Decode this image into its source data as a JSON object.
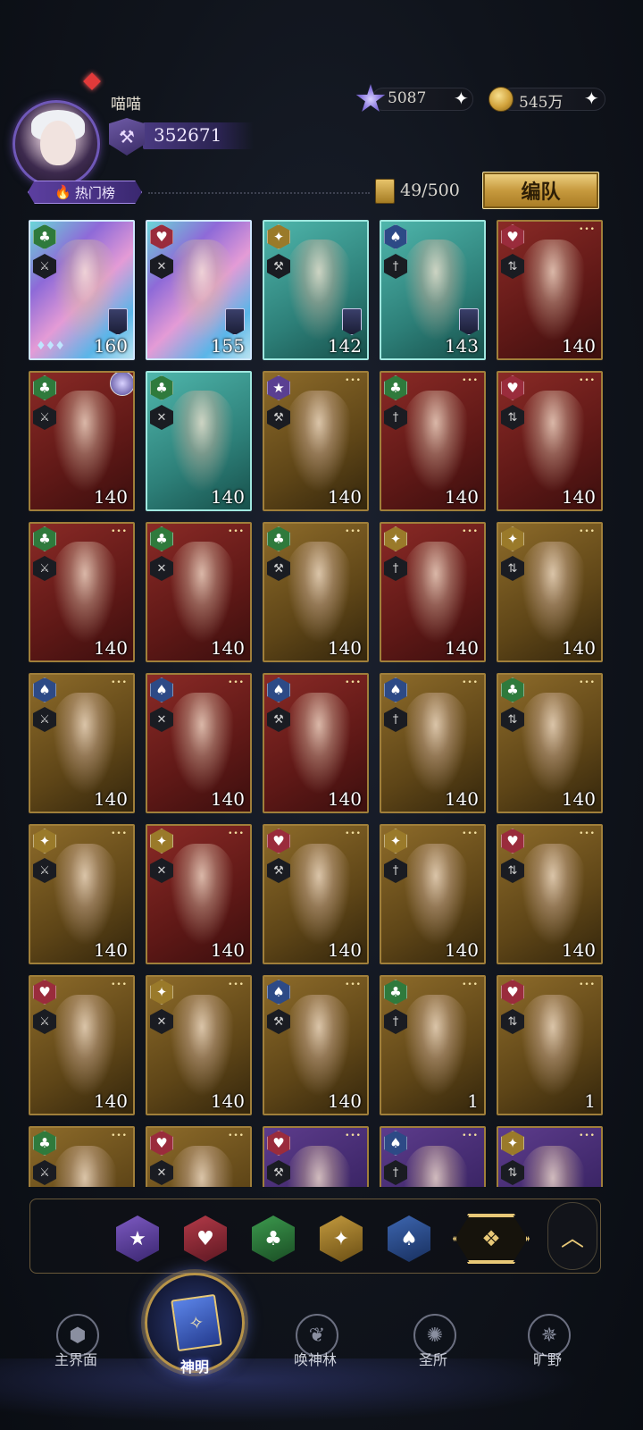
{
  "player": {
    "name": "喵喵",
    "power": "352671"
  },
  "currencies": [
    {
      "icon": "star-gem-icon",
      "value": "5087"
    },
    {
      "icon": "gold-coin-icon",
      "value": "545万"
    }
  ],
  "toolbar": {
    "hot_label": "热门榜",
    "card_count": "49/500",
    "team_button": "编队"
  },
  "cards": [
    {
      "suit": "club",
      "bg": "holo",
      "level": "160"
    },
    {
      "suit": "heart",
      "bg": "holo",
      "level": "155"
    },
    {
      "suit": "diamond",
      "bg": "teal",
      "level": "142"
    },
    {
      "suit": "spade",
      "bg": "teal",
      "level": "143"
    },
    {
      "suit": "heart",
      "bg": "red",
      "level": "140"
    },
    {
      "suit": "club",
      "bg": "red",
      "level": "140"
    },
    {
      "suit": "club",
      "bg": "teal",
      "level": "140"
    },
    {
      "suit": "star",
      "bg": "gold",
      "level": "140"
    },
    {
      "suit": "club",
      "bg": "red",
      "level": "140"
    },
    {
      "suit": "heart",
      "bg": "red",
      "level": "140"
    },
    {
      "suit": "club",
      "bg": "red",
      "level": "140"
    },
    {
      "suit": "club",
      "bg": "red",
      "level": "140"
    },
    {
      "suit": "club",
      "bg": "gold",
      "level": "140"
    },
    {
      "suit": "diamond",
      "bg": "red",
      "level": "140"
    },
    {
      "suit": "diamond",
      "bg": "gold",
      "level": "140"
    },
    {
      "suit": "spade",
      "bg": "gold",
      "level": "140"
    },
    {
      "suit": "spade",
      "bg": "red",
      "level": "140"
    },
    {
      "suit": "spade",
      "bg": "red",
      "level": "140"
    },
    {
      "suit": "spade",
      "bg": "gold",
      "level": "140"
    },
    {
      "suit": "club",
      "bg": "gold",
      "level": "140"
    },
    {
      "suit": "diamond",
      "bg": "gold",
      "level": "140"
    },
    {
      "suit": "diamond",
      "bg": "red",
      "level": "140"
    },
    {
      "suit": "heart",
      "bg": "gold",
      "level": "140"
    },
    {
      "suit": "diamond",
      "bg": "gold",
      "level": "140"
    },
    {
      "suit": "heart",
      "bg": "gold",
      "level": "140"
    },
    {
      "suit": "heart",
      "bg": "gold",
      "level": "140"
    },
    {
      "suit": "diamond",
      "bg": "gold",
      "level": "140"
    },
    {
      "suit": "spade",
      "bg": "gold",
      "level": "140"
    },
    {
      "suit": "club",
      "bg": "gold",
      "level": "1"
    },
    {
      "suit": "heart",
      "bg": "gold",
      "level": "1"
    },
    {
      "suit": "club",
      "bg": "gold",
      "level": ""
    },
    {
      "suit": "heart",
      "bg": "gold",
      "level": ""
    },
    {
      "suit": "heart",
      "bg": "purple",
      "level": ""
    },
    {
      "suit": "spade",
      "bg": "purple",
      "level": ""
    },
    {
      "suit": "diamond",
      "bg": "purple",
      "level": ""
    }
  ],
  "filters": [
    {
      "icon": "star-filter-icon",
      "glyph": "★"
    },
    {
      "icon": "heart-filter-icon",
      "glyph": "♥"
    },
    {
      "icon": "club-filter-icon",
      "glyph": "♣"
    },
    {
      "icon": "diamond-filter-icon",
      "glyph": "✦"
    },
    {
      "icon": "spade-filter-icon",
      "glyph": "♠"
    }
  ],
  "nav": {
    "items": [
      {
        "label": "主界面"
      },
      {
        "label": "神明"
      },
      {
        "label": "唤神林"
      },
      {
        "label": "圣所"
      },
      {
        "label": "旷野"
      }
    ]
  }
}
